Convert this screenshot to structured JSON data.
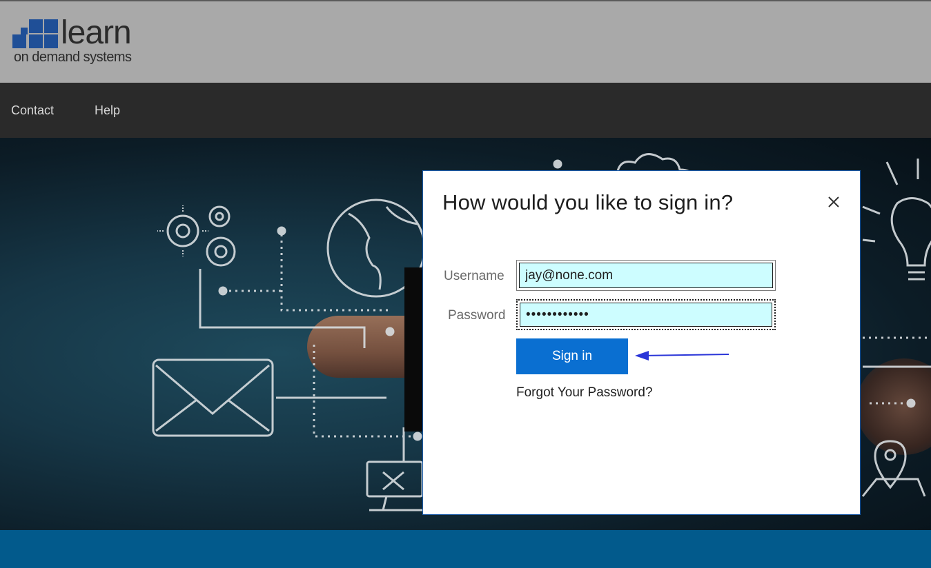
{
  "header": {
    "logo_word": "learn",
    "logo_tagline": "on demand systems"
  },
  "nav": {
    "items": [
      {
        "label": "Contact"
      },
      {
        "label": "Help"
      }
    ]
  },
  "modal": {
    "title": "How would you like to sign in?",
    "username_label": "Username",
    "username_value": "jay@none.com",
    "password_label": "Password",
    "password_value": "••••••••••••",
    "signin_label": "Sign in",
    "forgot_label": "Forgot Your Password?"
  },
  "colors": {
    "header_bg": "#a9a9a9",
    "nav_bg": "#2a2a2a",
    "logo_blue": "#1f4f97",
    "button_blue": "#0a6fd1",
    "field_bg": "#cdfdff",
    "footer_blue": "#025a8c",
    "annotation_arrow": "#2a35d8"
  },
  "icons": {
    "close": "close-icon",
    "annotation": "arrow-left-icon"
  }
}
